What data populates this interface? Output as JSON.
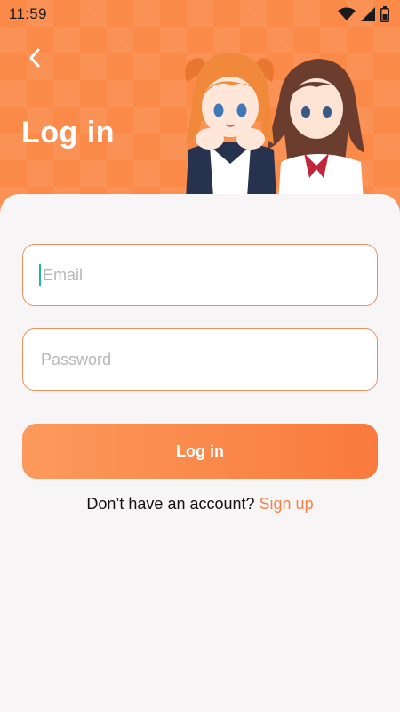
{
  "status_bar": {
    "time": "11:59",
    "icons": [
      "wifi-icon",
      "signal-icon",
      "battery-icon"
    ]
  },
  "header": {
    "title": "Log in",
    "back_icon": "chevron-left-icon"
  },
  "form": {
    "email_placeholder": "Email",
    "password_placeholder": "Password",
    "login_label": "Log in"
  },
  "footer": {
    "prompt": "Don’t have an account? ",
    "signup_label": "Sign up"
  },
  "colors": {
    "brand": "#fb8a48",
    "accent_text": "#f0844a",
    "field_border": "#ec8f5e",
    "caret": "#1bb7a8",
    "background": "#f8f5f6"
  }
}
